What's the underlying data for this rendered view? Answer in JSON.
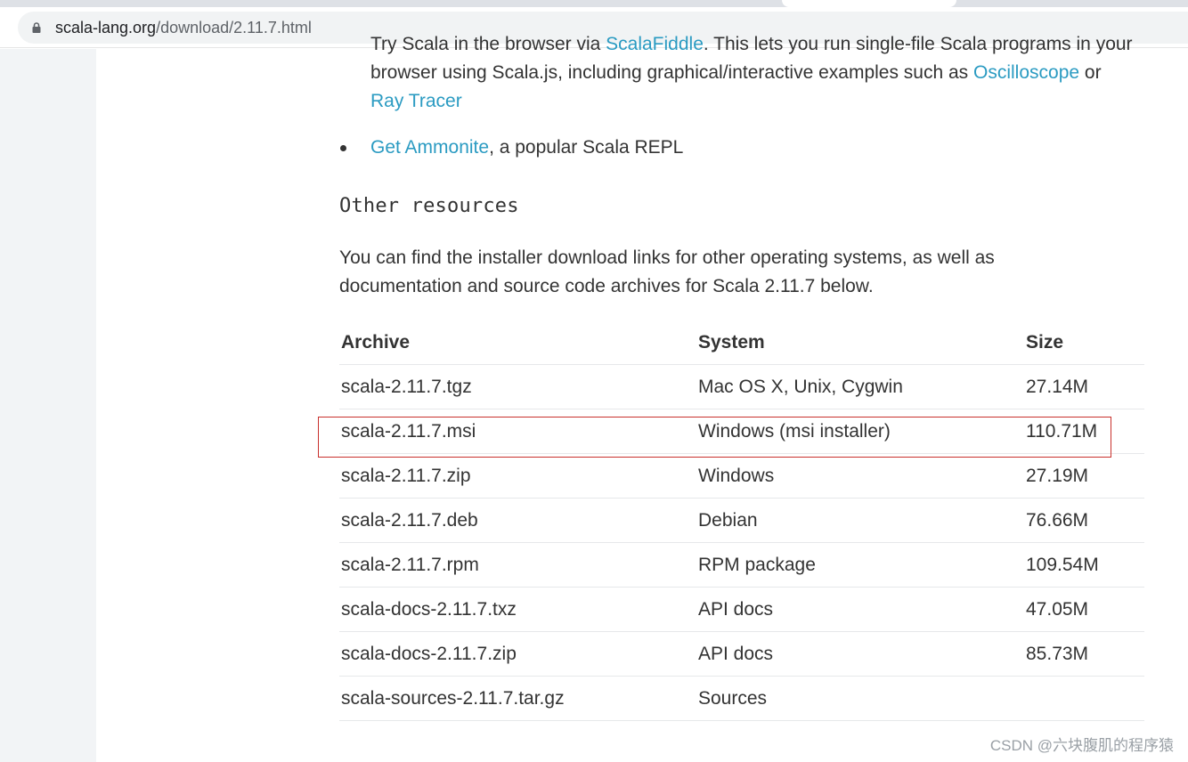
{
  "browser": {
    "url_host": "scala-lang.org",
    "url_path": "/download/2.11.7.html"
  },
  "content": {
    "scalafiddle_line": {
      "text_before": "Try Scala in the browser via ",
      "link": "ScalaFiddle",
      "text_after": ". This lets you run single-file Scala programs in your"
    },
    "scalafiddle_line2": {
      "text": "browser using Scala.js, including graphical/interactive examples such as ",
      "link": "Oscilloscope",
      "text_after": " or"
    },
    "scalafiddle_line3": {
      "link": "Ray Tracer"
    },
    "ammonite_item": {
      "link": "Get Ammonite",
      "text": ", a popular Scala REPL"
    },
    "other_resources_heading": "Other resources",
    "intro_line1": "You can find the installer download links for other operating systems, as well as",
    "intro_line2": "documentation and source code archives for Scala 2.11.7 below."
  },
  "table": {
    "headers": {
      "archive": "Archive",
      "system": "System",
      "size": "Size"
    },
    "rows": [
      {
        "archive": "scala-2.11.7.tgz",
        "system": "Mac OS X, Unix, Cygwin",
        "size": "27.14M"
      },
      {
        "archive": "scala-2.11.7.msi",
        "system": "Windows (msi installer)",
        "size": "110.71M"
      },
      {
        "archive": "scala-2.11.7.zip",
        "system": "Windows",
        "size": "27.19M"
      },
      {
        "archive": "scala-2.11.7.deb",
        "system": "Debian",
        "size": "76.66M"
      },
      {
        "archive": "scala-2.11.7.rpm",
        "system": "RPM package",
        "size": "109.54M"
      },
      {
        "archive": "scala-docs-2.11.7.txz",
        "system": "API docs",
        "size": "47.05M"
      },
      {
        "archive": "scala-docs-2.11.7.zip",
        "system": "API docs",
        "size": "85.73M"
      },
      {
        "archive": "scala-sources-2.11.7.tar.gz",
        "system": "Sources",
        "size": ""
      }
    ]
  },
  "watermark": "CSDN @六块腹肌的程序猿",
  "colors": {
    "link": "#2b9bc2",
    "highlight": "#c9302c",
    "sidebar": "#f2f4f6"
  }
}
